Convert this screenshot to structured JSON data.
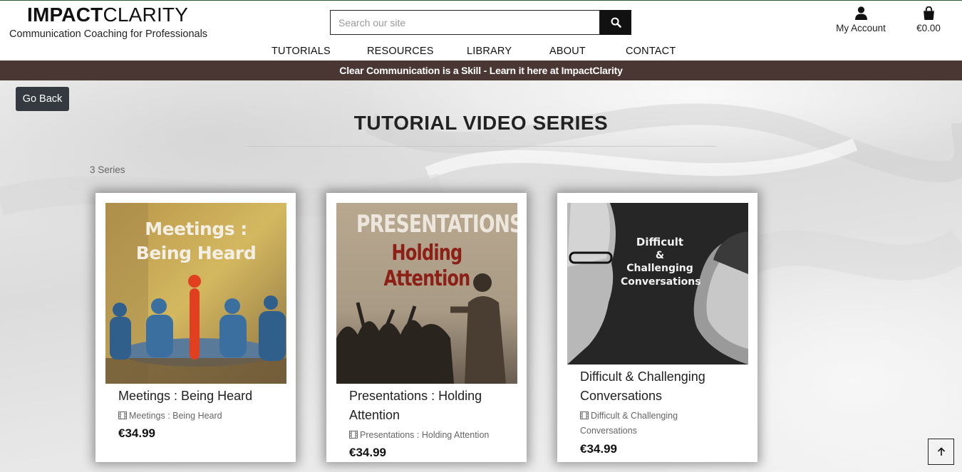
{
  "header": {
    "logo_bold": "IMPACT",
    "logo_light": "CLARITY",
    "tagline": "Communication Coaching for Professionals",
    "search_placeholder": "Search our site",
    "account_label": "My Account",
    "basket_total": "€0.00"
  },
  "nav": [
    "TUTORIALS",
    "RESOURCES",
    "LIBRARY",
    "ABOUT",
    "CONTACT"
  ],
  "banner": "Clear Communication is a Skill - Learn it here at ImpactClarity",
  "page": {
    "back_label": "Go Back",
    "title": "TUTORIAL VIDEO SERIES",
    "count": "3 Series"
  },
  "products": [
    {
      "title": "Meetings : Being Heard",
      "category": "Meetings : Being Heard",
      "price": "€34.99",
      "image_text": [
        "Meetings :",
        "Being Heard"
      ]
    },
    {
      "title": "Presentations : Holding Attention",
      "category": "Presentations : Holding Attention",
      "price": "€34.99",
      "image_text": [
        "PRESENTATIONS",
        "Holding Attention"
      ]
    },
    {
      "title": "Difficult & Challenging Conversations",
      "category": "Difficult & Challenging Conversations",
      "price": "€34.99",
      "image_text": [
        "Difficult",
        "& Challenging",
        "Conversations"
      ]
    }
  ],
  "colors": {
    "banner": "#4a3734",
    "button": "#343a40",
    "search_button": "#111111"
  },
  "icons": [
    "search-icon",
    "user-icon",
    "shopping-bag-icon",
    "film-icon",
    "arrow-up-icon"
  ]
}
